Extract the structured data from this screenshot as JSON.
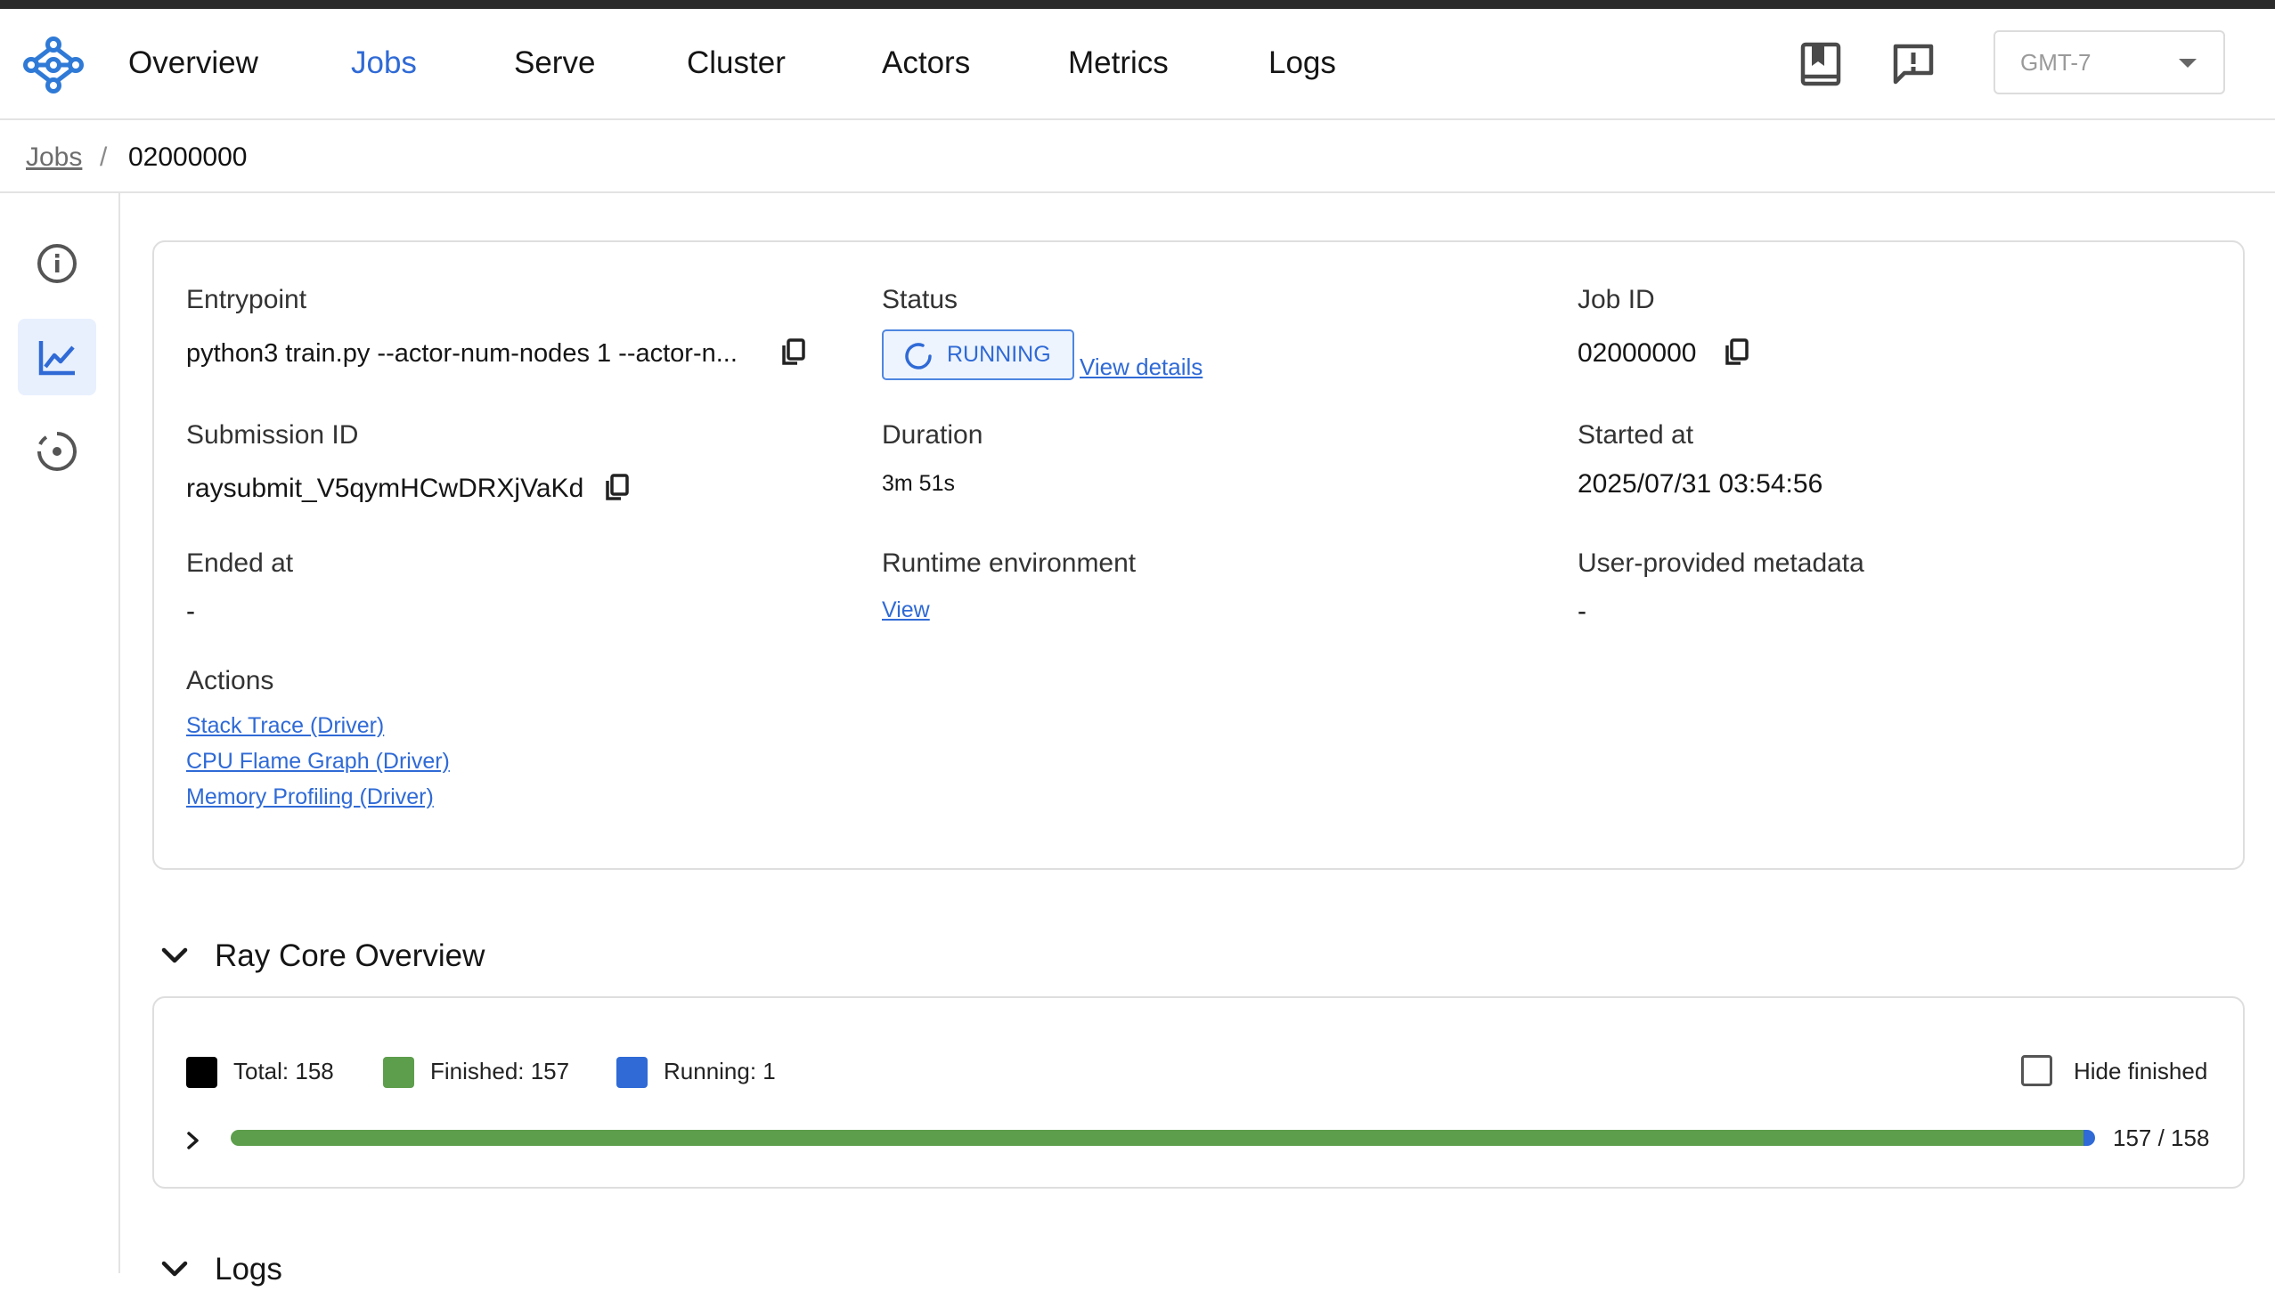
{
  "nav": {
    "items": [
      {
        "label": "Overview",
        "active": false
      },
      {
        "label": "Jobs",
        "active": true
      },
      {
        "label": "Serve",
        "active": false
      },
      {
        "label": "Cluster",
        "active": false
      },
      {
        "label": "Actors",
        "active": false
      },
      {
        "label": "Metrics",
        "active": false
      },
      {
        "label": "Logs",
        "active": false
      }
    ],
    "icons": [
      "docs-book-icon",
      "feedback-icon"
    ],
    "timezone": "GMT-7"
  },
  "breadcrumb": {
    "parent": "Jobs",
    "separator": "/",
    "current": "02000000"
  },
  "sidebar": {
    "items": [
      {
        "icon": "info-icon",
        "active": false
      },
      {
        "icon": "chart-line-icon",
        "active": true
      },
      {
        "icon": "ray-core-icon",
        "active": false
      }
    ]
  },
  "job": {
    "entrypoint_label": "Entrypoint",
    "entrypoint": "python3 train.py --actor-num-nodes 1 --actor-n...",
    "status_label": "Status",
    "status": "RUNNING",
    "view_details": "View details",
    "job_id_label": "Job ID",
    "job_id": "02000000",
    "submission_id_label": "Submission ID",
    "submission_id": "raysubmit_V5qymHCwDRXjVaKd",
    "duration_label": "Duration",
    "duration": "3m 51s",
    "started_at_label": "Started at",
    "started_at": "2025/07/31 03:54:56",
    "ended_at_label": "Ended at",
    "ended_at": "-",
    "runtime_env_label": "Runtime environment",
    "runtime_env_link": "View",
    "metadata_label": "User-provided metadata",
    "metadata": "-",
    "actions_label": "Actions",
    "actions": [
      "Stack Trace (Driver)",
      "CPU Flame Graph (Driver)",
      "Memory Profiling (Driver)"
    ]
  },
  "ray_core": {
    "title": "Ray Core Overview",
    "legend": {
      "total": "Total: 158",
      "finished": "Finished: 157",
      "running": "Running: 1"
    },
    "hide_finished": "Hide finished",
    "progress": {
      "finished": 157,
      "running": 1,
      "total": 158,
      "label": "157 / 158"
    },
    "colors": {
      "total": "#000000",
      "finished": "#5d9e4c",
      "running": "#2f6ad6"
    }
  },
  "logs_section": {
    "title": "Logs"
  }
}
